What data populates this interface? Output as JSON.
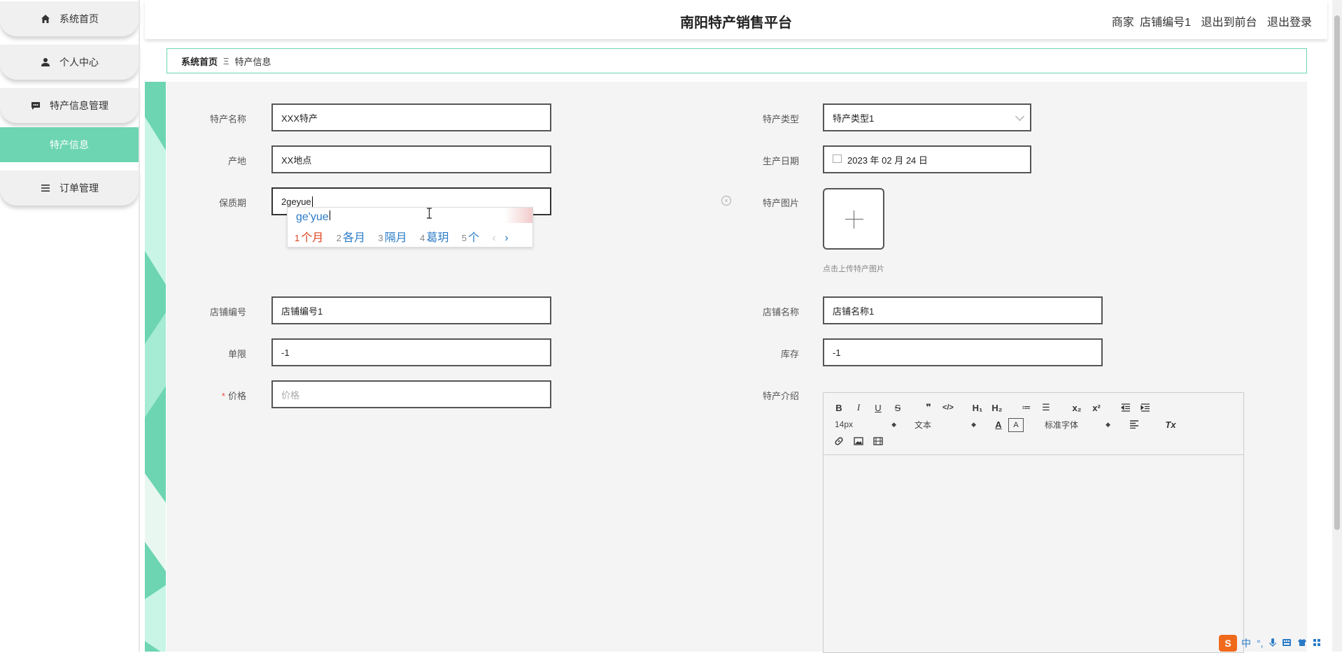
{
  "sidebar": {
    "items": [
      {
        "label": "系统首页",
        "icon": "home-icon"
      },
      {
        "label": "个人中心",
        "icon": "user-icon"
      },
      {
        "label": "特产信息管理",
        "icon": "chat-icon"
      },
      {
        "label": "特产信息",
        "icon": ""
      },
      {
        "label": "订单管理",
        "icon": "list-icon"
      }
    ],
    "active_index": 3,
    "accent_color": "#6dd5b1"
  },
  "header": {
    "title": "南阳特产销售平台",
    "user_role": "商家",
    "user_name": "店铺编号1",
    "to_frontend": "退出到前台",
    "logout": "退出登录"
  },
  "breadcrumb": {
    "home": "系统首页",
    "separator": "Ξ",
    "current": "特产信息"
  },
  "form": {
    "name": {
      "label": "特产名称",
      "value": "XXX特产"
    },
    "type": {
      "label": "特产类型",
      "value": "特产类型1"
    },
    "origin": {
      "label": "产地",
      "value": "XX地点"
    },
    "date": {
      "label": "生产日期",
      "value": "2023 年 02 月 24 日"
    },
    "shelf_life": {
      "label": "保质期",
      "value": "2geyue"
    },
    "image": {
      "label": "特产图片",
      "tip": "点击上传特产图片"
    },
    "shop_no": {
      "label": "店铺编号",
      "value": "店铺编号1"
    },
    "shop_name": {
      "label": "店铺名称",
      "value": "店铺名称1"
    },
    "limit": {
      "label": "单限",
      "value": "-1"
    },
    "stock": {
      "label": "库存",
      "value": "-1"
    },
    "price": {
      "label": "价格",
      "placeholder": "价格",
      "required_mark": "*"
    },
    "intro": {
      "label": "特产介绍"
    }
  },
  "ime_popup": {
    "pinyin": "ge'yue",
    "candidates": [
      {
        "n": "1",
        "text": "个月"
      },
      {
        "n": "2",
        "text": "各月"
      },
      {
        "n": "3",
        "text": "隔月"
      },
      {
        "n": "4",
        "text": "葛玥"
      },
      {
        "n": "5",
        "text": "个"
      }
    ],
    "prev": "‹",
    "next": "›"
  },
  "editor_toolbar": {
    "size": "14px",
    "format": "文本",
    "font": "标准字体",
    "bold": "B",
    "italic": "I",
    "underline": "U",
    "strike": "S",
    "quote": "❞",
    "code": "</>",
    "h1": "H₁",
    "h2": "H₂",
    "sub": "x₂",
    "sup": "x²",
    "clean": "Tx",
    "ordered": "≔",
    "bullet": "☰",
    "color": "A",
    "background": "A"
  },
  "ime_status": {
    "logo": "S",
    "mode": "中",
    "punct": "°,"
  }
}
